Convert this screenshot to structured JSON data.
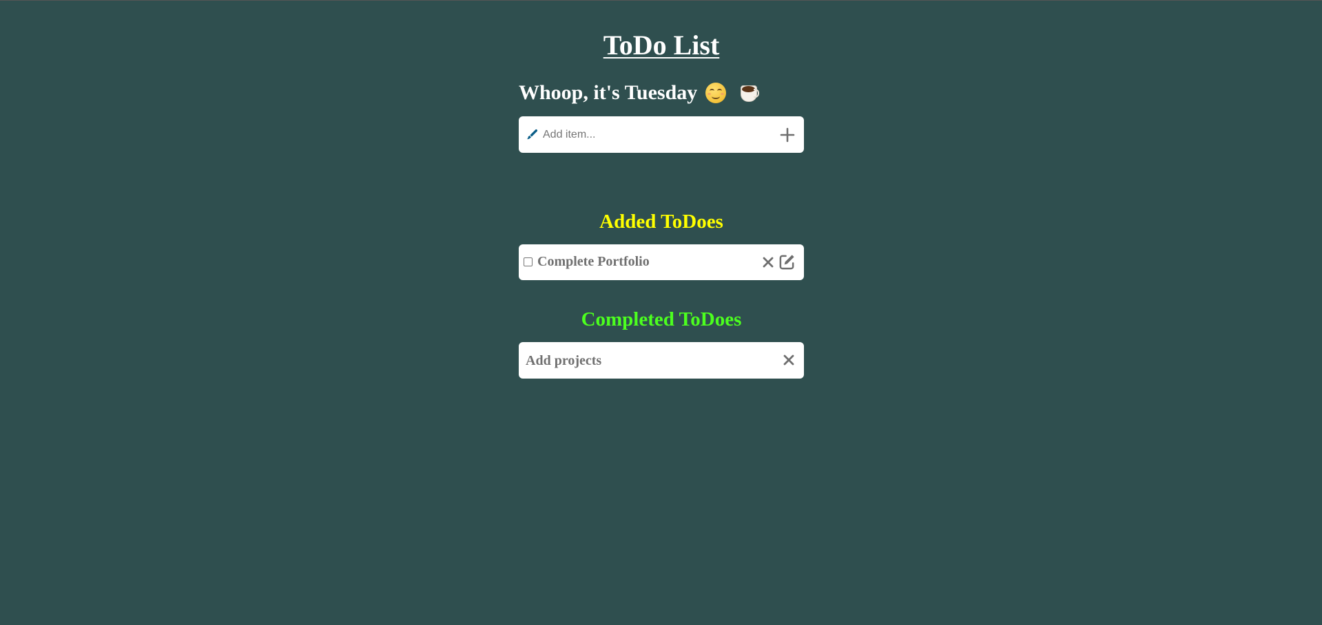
{
  "header": {
    "title": "ToDo List",
    "greeting": "Whoop, it's Tuesday",
    "emojis": [
      "smiling-face-emoji",
      "coffee-cup-emoji"
    ]
  },
  "add_item": {
    "placeholder": "Add item...",
    "value": "",
    "icons": {
      "left": "pen-icon",
      "right": "plus-icon"
    }
  },
  "added_section": {
    "title": "Added ToDoes",
    "title_color": "#ffff00",
    "items": [
      {
        "text": "Complete Portfolio",
        "checked": false,
        "actions": [
          "close-icon",
          "edit-icon"
        ]
      }
    ]
  },
  "completed_section": {
    "title": "Completed ToDoes",
    "title_color": "#4cff1f",
    "items": [
      {
        "text": "Add projects",
        "actions": [
          "close-icon"
        ]
      }
    ]
  },
  "colors": {
    "background": "#2f4f4f",
    "card": "#ffffff",
    "muted_text": "#707070",
    "pen_icon": "#0b5e88"
  }
}
